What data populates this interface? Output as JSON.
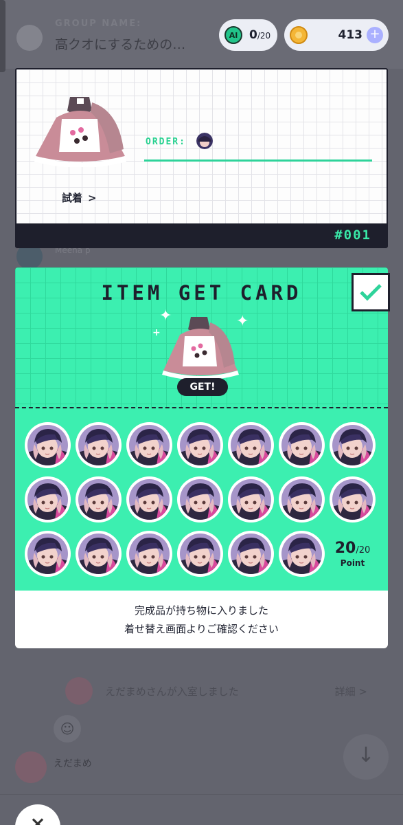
{
  "header": {
    "group_label": "GROUP NAME:",
    "group_name": "高クオにするための…",
    "ai_credits": "0",
    "ai_credits_total": "/20",
    "ai_label": "AI",
    "coins": "413",
    "plus_symbol": "+"
  },
  "order_card": {
    "order_label": "ORDER:",
    "try_on_label": "試着",
    "try_on_chevron": ">",
    "order_number": "#001"
  },
  "background_chat": {
    "member_name": "Meena p",
    "join_message": "えだまめさんが入室しました",
    "detail_link": "詳細 >",
    "user_name": "えだまめ",
    "emoji_icon": "☺",
    "scroll_icon": "↓"
  },
  "item_get_card": {
    "title": "ITEM GET CARD",
    "get_badge": "GET!",
    "stamps_collected": 20,
    "points_value": "20",
    "points_total": "/20",
    "points_label": "Point",
    "accent_color": "#3cefb0",
    "dark_color": "#1e1f2c"
  },
  "message": {
    "line1": "完成品が持ち物に入りました",
    "line2": "着せ替え画面よりご確認ください"
  },
  "close_button": "×"
}
